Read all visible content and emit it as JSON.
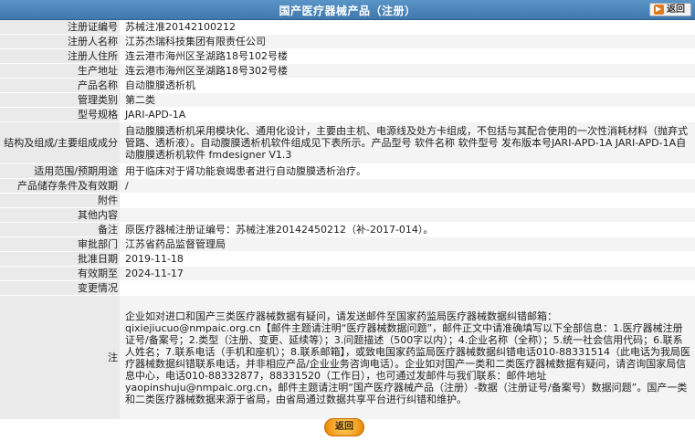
{
  "header": {
    "title": "国产医疗器械产品（注册）",
    "back_label": "返回"
  },
  "rows": [
    {
      "label": "注册证编号",
      "value": "苏械注准20142100212"
    },
    {
      "label": "注册人名称",
      "value": "江苏杰瑞科技集团有限责任公司"
    },
    {
      "label": "注册人住所",
      "value": "连云港市海州区圣湖路18号102号楼"
    },
    {
      "label": "生产地址",
      "value": "连云港市海州区圣湖路18号302号楼"
    },
    {
      "label": "产品名称",
      "value": "自动腹膜透析机"
    },
    {
      "label": "管理类别",
      "value": "第二类"
    },
    {
      "label": "型号规格",
      "value": "JARI-APD-1A"
    },
    {
      "label": "结构及组成/主要组成成分",
      "value": "自动腹膜透析机采用模块化、通用化设计，主要由主机、电源线及处方卡组成，不包括与其配合使用的一次性消耗材料（抛弃式管路、透析液）。自动腹膜透析机软件组成见下表所示。产品型号 软件名称 软件型号 发布版本号JARI-APD-1A JARI-APD-1A自动腹膜透析机软件 fmdesigner V1.3"
    },
    {
      "label": "适用范围/预期用途",
      "value": "用于临床对于肾功能衰竭患者进行自动腹膜透析治疗。"
    },
    {
      "label": "产品储存条件及有效期",
      "value": "/"
    },
    {
      "label": "附件",
      "value": ""
    },
    {
      "label": "其他内容",
      "value": ""
    },
    {
      "label": "备注",
      "value": "原医疗器械注册证编号：苏械注准20142450212（补-2017-014）。"
    },
    {
      "label": "审批部门",
      "value": "江苏省药品监督管理局"
    },
    {
      "label": "批准日期",
      "value": "2019-11-18"
    },
    {
      "label": "有效期至",
      "value": "2024-11-17"
    },
    {
      "label": "变更情况",
      "value": ""
    }
  ],
  "note": {
    "label": "注",
    "text": "企业如对进口和国产三类医疗器械数据有疑问，请发送邮件至国家药监局医疗器械数据纠错邮箱：qixiejiucuo@nmpaic.org.cn【邮件主题请注明“医疗器械数据问题”，邮件正文中请准确填写以下全部信息：1.医疗器械注册证号/备案号；2.类型（注册、变更、延续等）；3.问题描述（500字以内）；4.企业名称（全称）；5.统一社会信用代码；6.联系人姓名；7.联系电话（手机和座机）；8.联系邮箱】，或致电国家药监局医疗器械数据纠错电话010-88331514（此电话为我局医疗器械数据纠错联系电话，并非相应产品/企业业务咨询电话）。企业如对国产一类和二类医疗器械数据有疑问，请咨询国家局信息中心，电话010-88332877，88331520（工作日），也可通过发邮件与我们联系：邮件地址yaopinshuju@nmpaic.org.cn，邮件主题请注明“国产医疗器械产品（注册）-数据（注册证号/备案号）数据问题”。国产一类和二类医疗器械数据来源于省局，由省局通过数据共享平台进行纠错和维护。"
  },
  "footer": {
    "back_label": "返回"
  },
  "colors": {
    "header_bg": "#4a86bb",
    "label_bg": "#eaeaea",
    "alt_row_bg": "#f4f4f4",
    "back_button": "#f29b1c"
  }
}
